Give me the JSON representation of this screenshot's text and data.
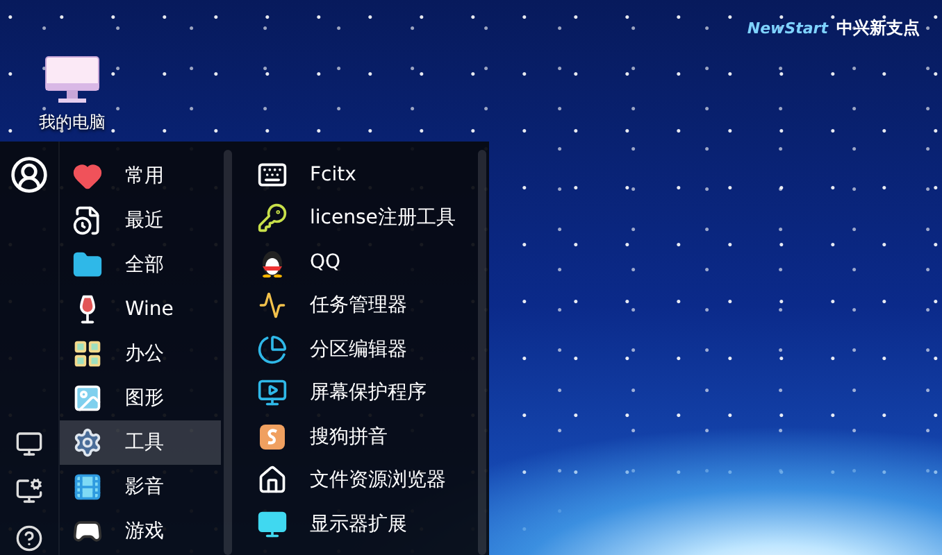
{
  "desktop_icons": [
    {
      "label": "我的电脑"
    }
  ],
  "logo": {
    "brand": "NewStart",
    "name": "中兴新支点"
  },
  "menu": {
    "categories": [
      {
        "label": "常用",
        "selected": false
      },
      {
        "label": "最近",
        "selected": false
      },
      {
        "label": "全部",
        "selected": false
      },
      {
        "label": "Wine",
        "selected": false
      },
      {
        "label": "办公",
        "selected": false
      },
      {
        "label": "图形",
        "selected": false
      },
      {
        "label": "工具",
        "selected": true
      },
      {
        "label": "影音",
        "selected": false
      },
      {
        "label": "游戏",
        "selected": false
      }
    ],
    "apps": [
      {
        "label": "Fcitx"
      },
      {
        "label": "license注册工具"
      },
      {
        "label": "QQ"
      },
      {
        "label": "任务管理器"
      },
      {
        "label": "分区编辑器"
      },
      {
        "label": "屏幕保护程序"
      },
      {
        "label": "搜狗拼音"
      },
      {
        "label": "文件资源浏览器"
      },
      {
        "label": "显示器扩展"
      }
    ]
  }
}
